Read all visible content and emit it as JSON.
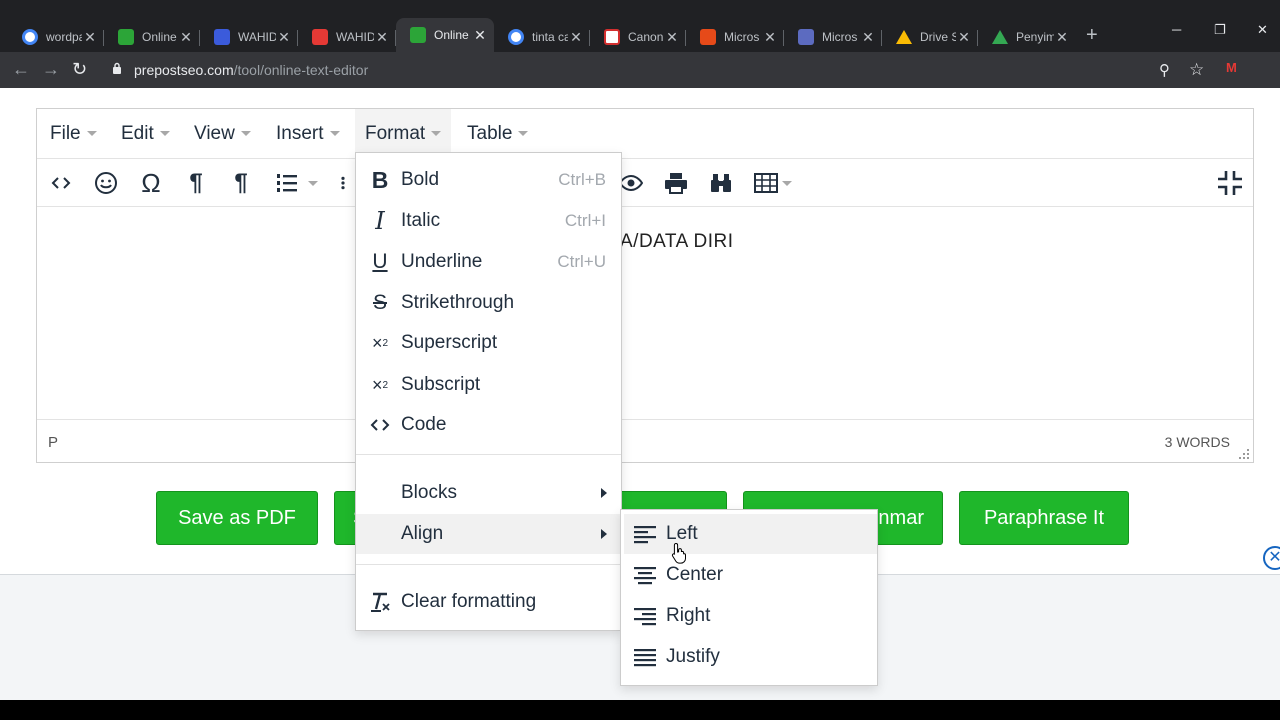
{
  "browser": {
    "tabs": [
      {
        "title": "wordpa",
        "favicon_color": "#4285f4",
        "active": false
      },
      {
        "title": "Online",
        "favicon_color": "#2ca538",
        "active": false
      },
      {
        "title": "WAHID",
        "favicon_color": "#3b5bdb",
        "active": false
      },
      {
        "title": "WAHID",
        "favicon_color": "#e53935",
        "active": false
      },
      {
        "title": "Online",
        "favicon_color": "#2ca538",
        "active": true
      },
      {
        "title": "tinta ca",
        "favicon_color": "#4285f4",
        "active": false
      },
      {
        "title": "Canon",
        "favicon_color": "#d32f2f",
        "active": false
      },
      {
        "title": "Micros",
        "favicon_color": "#e64a19",
        "active": false
      },
      {
        "title": "Micros",
        "favicon_color": "#5c6bc0",
        "active": false
      },
      {
        "title": "Drive S",
        "favicon_color": "#fbbc04",
        "active": false
      },
      {
        "title": "Penyim",
        "favicon_color": "#34a853",
        "active": false
      }
    ],
    "new_tab": "+",
    "url_host": "prepostseo.com",
    "url_path": "/tool/online-text-editor"
  },
  "editor": {
    "menus": [
      "File",
      "Edit",
      "View",
      "Insert",
      "Format",
      "Table"
    ],
    "active_menu": "Format",
    "content_text": "A/DATA DIRI",
    "status_path": "P",
    "word_count": "3 WORDS"
  },
  "format_menu": {
    "items": [
      {
        "label": "Bold",
        "shortcut": "Ctrl+B",
        "icon": "bold-icon"
      },
      {
        "label": "Italic",
        "shortcut": "Ctrl+I",
        "icon": "italic-icon"
      },
      {
        "label": "Underline",
        "shortcut": "Ctrl+U",
        "icon": "underline-icon"
      },
      {
        "label": "Strikethrough",
        "shortcut": "",
        "icon": "strikethrough-icon"
      },
      {
        "label": "Superscript",
        "shortcut": "",
        "icon": "superscript-icon"
      },
      {
        "label": "Subscript",
        "shortcut": "",
        "icon": "subscript-icon"
      },
      {
        "label": "Code",
        "shortcut": "",
        "icon": "code-icon"
      }
    ],
    "submenus": [
      "Blocks",
      "Align"
    ],
    "clear": "Clear formatting"
  },
  "align_menu": {
    "items": [
      "Left",
      "Center",
      "Right",
      "Justify"
    ],
    "highlighted": "Left"
  },
  "buttons": {
    "save_pdf": "Save as PDF",
    "btn2": "S",
    "btn4": "nmar",
    "paraphrase": "Paraphrase It"
  },
  "colors": {
    "button_green": "#1fb72b",
    "menu_text": "#222f3e",
    "chrome_dark": "#202124"
  }
}
